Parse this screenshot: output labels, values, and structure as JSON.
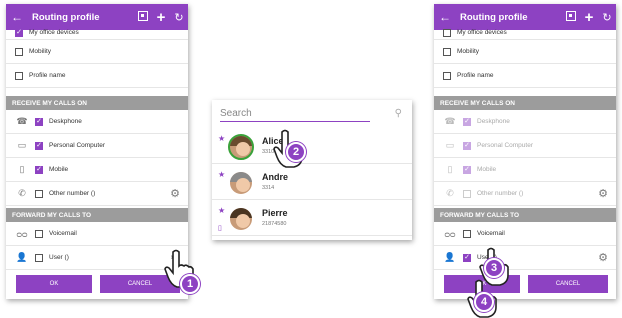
{
  "colors": {
    "accent": "#8d42c2",
    "section": "#9c9c9c"
  },
  "screen1": {
    "title": "Routing profile",
    "options": [
      {
        "label": "My office devices",
        "checked": true
      },
      {
        "label": "Mobility",
        "checked": false
      },
      {
        "label": "Profile name",
        "checked": false
      }
    ],
    "receive_header": "RECEIVE MY CALLS ON",
    "receive": [
      {
        "label": "Deskphone",
        "checked": true,
        "icon": "deskphone-icon"
      },
      {
        "label": "Personal Computer",
        "checked": true,
        "icon": "computer-icon"
      },
      {
        "label": "Mobile",
        "checked": true,
        "icon": "mobile-icon"
      },
      {
        "label": "Other number ()",
        "checked": false,
        "icon": "handset-icon"
      }
    ],
    "forward_header": "FORWARD MY CALLS TO",
    "forward": [
      {
        "label": "Voicemail",
        "checked": false,
        "icon": "voicemail-icon"
      },
      {
        "label": "User ()",
        "checked": false,
        "icon": "user-icon"
      }
    ],
    "ok": "OK",
    "cancel": "CANCEL",
    "step": "1"
  },
  "screen2": {
    "search_placeholder": "Search",
    "contacts": [
      {
        "name": "Alice",
        "number": "3310"
      },
      {
        "name": "Andre",
        "number": "3314"
      },
      {
        "name": "Pierre",
        "number": "21874580"
      }
    ],
    "step": "2"
  },
  "screen3": {
    "title": "Routing profile",
    "options": [
      {
        "label": "My office devices",
        "checked": false
      },
      {
        "label": "Mobility",
        "checked": false
      },
      {
        "label": "Profile name",
        "checked": false
      }
    ],
    "receive_header": "RECEIVE MY CALLS ON",
    "receive": [
      {
        "label": "Deskphone"
      },
      {
        "label": "Personal Computer"
      },
      {
        "label": "Mobile"
      },
      {
        "label": "Other number ()"
      }
    ],
    "forward_header": "FORWARD MY CALLS TO",
    "forward": [
      {
        "label": "Voicemail",
        "checked": false
      },
      {
        "label": "User ()",
        "checked": true
      }
    ],
    "ok": "OK",
    "cancel": "CANCEL",
    "steps": [
      "3",
      "4"
    ]
  }
}
